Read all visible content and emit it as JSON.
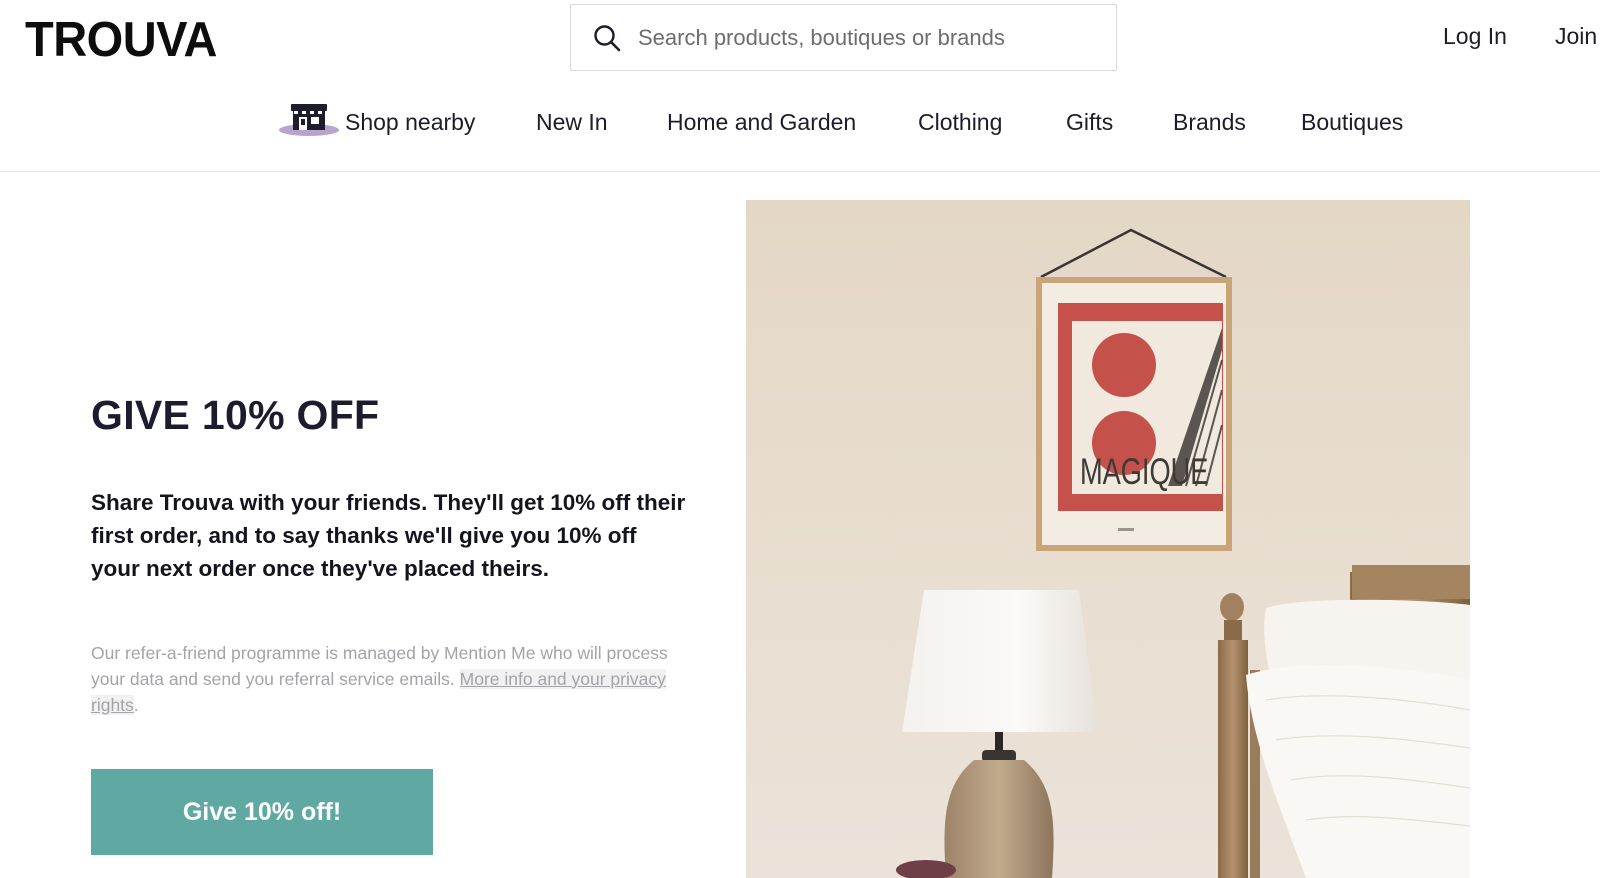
{
  "header": {
    "logo": "TROUVA",
    "search_placeholder": "Search products, boutiques or brands",
    "login_label": "Log In",
    "join_label": "Join"
  },
  "nav": {
    "items": [
      {
        "label": "Shop nearby",
        "icon": "shop-icon"
      },
      {
        "label": "New In"
      },
      {
        "label": "Home and Garden"
      },
      {
        "label": "Clothing"
      },
      {
        "label": "Gifts"
      },
      {
        "label": "Brands"
      },
      {
        "label": "Boutiques"
      }
    ]
  },
  "promo": {
    "title": "GIVE 10% OFF",
    "body": "Share Trouva with your friends. They'll get 10% off their first order, and to say thanks we'll give you 10% off your next order once they've placed theirs.",
    "legal_text": "Our refer-a-friend programme is managed by Mention Me who will process your data and send you referral service emails. ",
    "legal_link": "More info and your privacy rights",
    "legal_end": ".",
    "cta_label": "Give 10% off!"
  },
  "hero": {
    "poster_text": "MAGIQUE"
  },
  "colors": {
    "accent": "#60a8a2",
    "text": "#1c1c2e",
    "muted": "#a3a3a8"
  }
}
